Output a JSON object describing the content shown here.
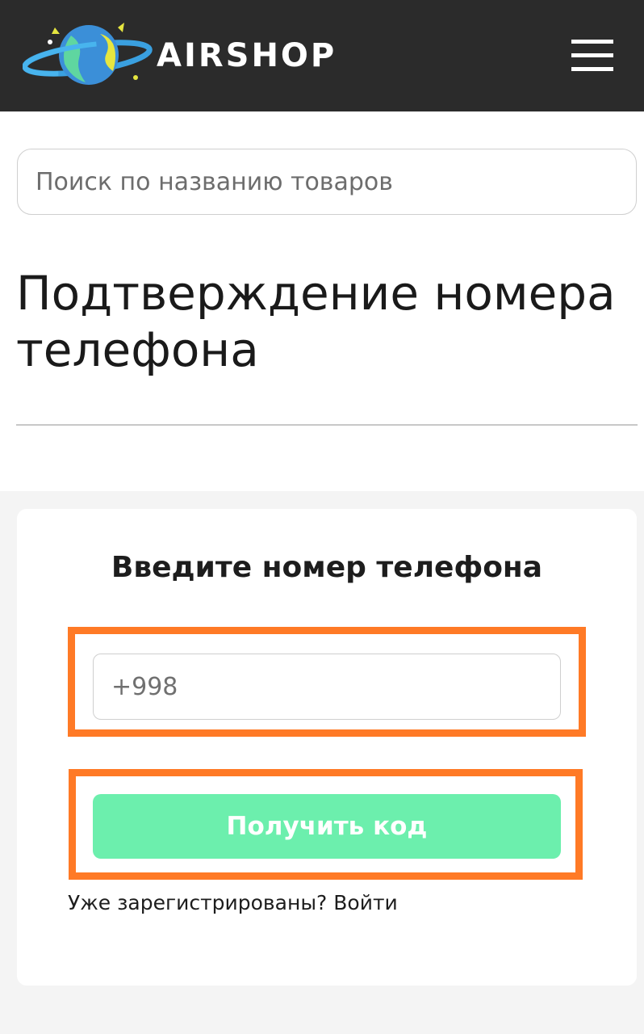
{
  "header": {
    "brand": "AIRSHOP",
    "menu_icon": "hamburger-menu-icon",
    "logo_icon": "planet-logo-icon",
    "background_color": "#2b2b2b"
  },
  "search": {
    "placeholder": "Поиск по названию товаров"
  },
  "page": {
    "title": "Подтверждение номера телефона"
  },
  "form": {
    "title": "Введите номер телефона",
    "phone_placeholder": "+998",
    "submit_label": "Получить код",
    "already_registered": "Уже зарегистрированы?",
    "login_link": "Войти",
    "button_color": "#6cefad",
    "highlight_color": "#ff7a26"
  }
}
